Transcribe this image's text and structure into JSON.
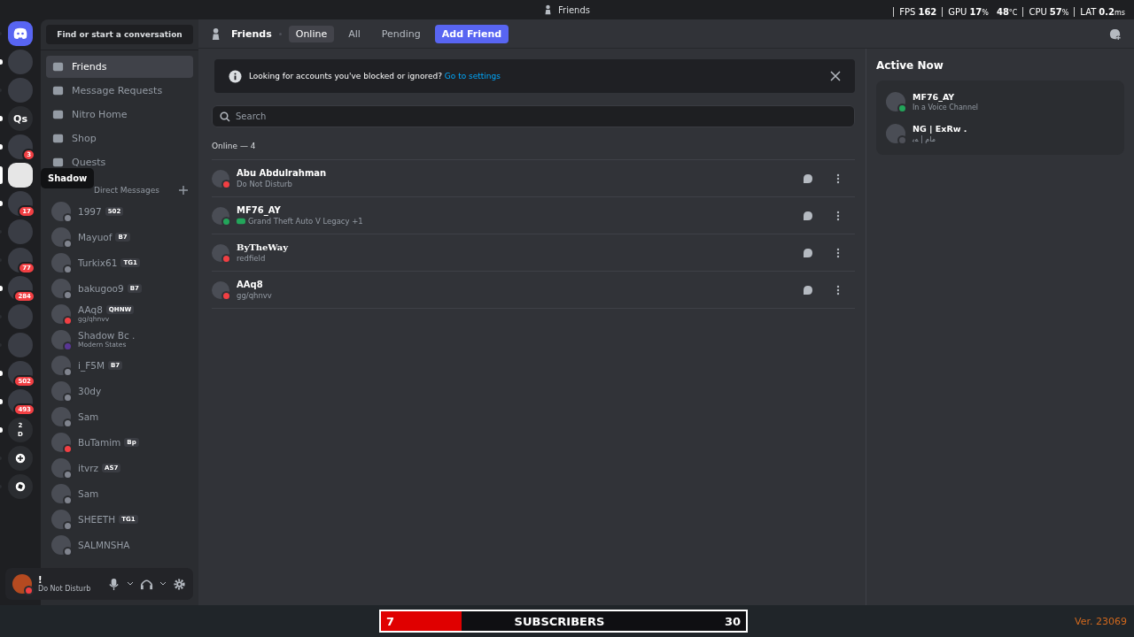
{
  "window": {
    "title": "Friends"
  },
  "overlay_stats": [
    {
      "label": "FPS",
      "value": "162"
    },
    {
      "label": "GPU",
      "value": "17",
      "unit": "%"
    },
    {
      "value": "48",
      "unit": "°C"
    },
    {
      "label": "CPU",
      "value": "57",
      "unit": "%"
    },
    {
      "label": "LAT",
      "value": "0.2",
      "unit": "ms"
    }
  ],
  "servers": [
    {
      "kind": "logo",
      "unread": false,
      "selected": false
    },
    {
      "kind": "image",
      "unread": true,
      "selected": false
    },
    {
      "kind": "image",
      "unread": false,
      "selected": false
    },
    {
      "kind": "text",
      "text": "Qs",
      "unread": true,
      "selected": false
    },
    {
      "kind": "image",
      "badge": "3",
      "unread": true,
      "selected": false
    },
    {
      "kind": "image",
      "unread": false,
      "selected": true
    },
    {
      "kind": "image",
      "badge": "17",
      "unread": true,
      "selected": false
    },
    {
      "kind": "image",
      "unread": false,
      "selected": false
    },
    {
      "kind": "image",
      "badge": "77",
      "unread": false,
      "selected": false
    },
    {
      "kind": "image",
      "badge": "284",
      "unread": true,
      "selected": false
    },
    {
      "kind": "image",
      "unread": false,
      "selected": false
    },
    {
      "kind": "image",
      "unread": false,
      "selected": false
    },
    {
      "kind": "image",
      "badge": "502",
      "unread": true,
      "selected": false
    },
    {
      "kind": "image",
      "badge": "493",
      "unread": true,
      "selected": false
    },
    {
      "kind": "folder",
      "text": "2",
      "text2": "D",
      "unread": true,
      "selected": false
    },
    {
      "kind": "add",
      "unread": false,
      "selected": false
    },
    {
      "kind": "discover",
      "unread": false,
      "selected": false
    }
  ],
  "tooltip": "Shadow",
  "search_button": "Find or start a conversation",
  "nav": [
    {
      "label": "Friends",
      "selected": true
    },
    {
      "label": "Message Requests",
      "selected": false
    },
    {
      "label": "Nitro Home",
      "selected": false
    },
    {
      "label": "Shop",
      "selected": false
    },
    {
      "label": "Quests",
      "selected": false
    }
  ],
  "dm_heading": "Direct Messages",
  "direct_messages": [
    {
      "name": "1997",
      "tag": "502",
      "color": "#80848e"
    },
    {
      "name": "Mayuof",
      "tag": "B7",
      "color": "#80848e"
    },
    {
      "name": "Turkix61",
      "tag": "TG1",
      "color": "#80848e"
    },
    {
      "name": "bakugoo9",
      "tag": "B7",
      "color": "#80848e"
    },
    {
      "name": "AAq8",
      "tag": "QHNW",
      "activity": "gg/qhnvv",
      "color": "#f23f43"
    },
    {
      "name": "Shadow Bc .",
      "activity": "Modern States",
      "color": "#593695"
    },
    {
      "name": "i_F5M",
      "tag": "B7",
      "color": "#80848e"
    },
    {
      "name": "30dy",
      "color": "#80848e"
    },
    {
      "name": "Sam",
      "color": "#80848e"
    },
    {
      "name": "BuTamim",
      "tag": "Bp",
      "color": "#f23f43"
    },
    {
      "name": "itvrz",
      "tag": "AS7",
      "color": "#80848e"
    },
    {
      "name": "Sam",
      "color": "#80848e"
    },
    {
      "name": "SHEETH",
      "tag": "TG1",
      "color": "#80848e"
    },
    {
      "name": "SALMNSHA",
      "color": "#80848e"
    }
  ],
  "user_panel": {
    "name": "!",
    "status_text": "Do Not Disturb",
    "color": "#f23f43"
  },
  "tabs": [
    {
      "label": "Online",
      "selected": true
    },
    {
      "label": "All",
      "selected": false
    },
    {
      "label": "Pending",
      "selected": false
    }
  ],
  "header_title": "Friends",
  "add_friend": "Add Friend",
  "notice": {
    "text": "Looking for accounts you've blocked or ignored?",
    "link": "Go to settings"
  },
  "search": {
    "placeholder": "Search"
  },
  "online_heading": "Online — 4",
  "friends": [
    {
      "name": "Abu Abdulrahman",
      "activity": "Do Not Disturb",
      "color": "#f23f43",
      "game": false,
      "decorated": false
    },
    {
      "name": "MF76_AY",
      "activity": "Grand Theft Auto V Legacy +1",
      "color": "#23a55a",
      "game": true,
      "decorated": false
    },
    {
      "name": "ByTheWay",
      "activity": "redfield",
      "color": "#f23f43",
      "game": false,
      "decorated": true
    },
    {
      "name": "AAq8",
      "activity": "gg/qhnvv",
      "color": "#f23f43",
      "game": false,
      "decorated": false
    }
  ],
  "active_now": {
    "title": "Active Now",
    "entries": [
      {
        "name": "MF76_AY",
        "detail": "In a Voice Channel",
        "color": "#23a55a"
      },
      {
        "name": "NG | ExRw .",
        "detail": "مام | ﻪﺑ",
        "color": "#4e5058"
      }
    ]
  },
  "subscriber_bar": {
    "current": "7",
    "label": "SUBSCRIBERS",
    "goal": "30",
    "level": 0.22
  },
  "version": "Ver. 23069"
}
